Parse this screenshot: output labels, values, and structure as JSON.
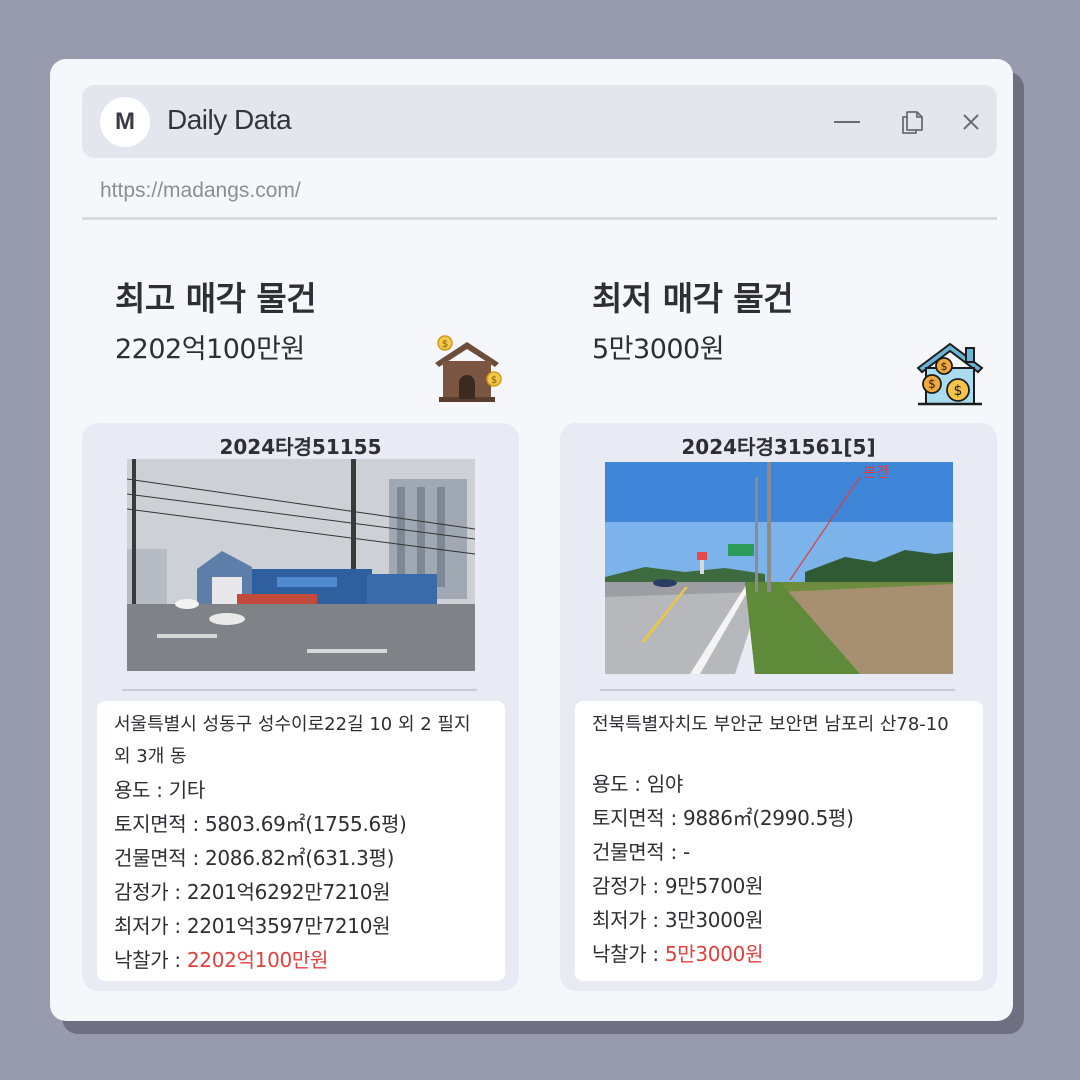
{
  "window": {
    "logo_letter": "M",
    "title": "Daily Data",
    "url": "https://madangs.com/"
  },
  "highest": {
    "heading": "최고 매각 물건",
    "price": "2202억100만원",
    "case_no": "2024타경51155",
    "address": "서울특별시 성동구 성수이로22길 10 외 2 필지 외 3개 동",
    "usage_label": "용도 : ",
    "usage": "기타",
    "land_label": "토지면적 : ",
    "land": "5803.69㎡(1755.6평)",
    "building_label": "건물면적 : ",
    "building": "2086.82㎡(631.3평)",
    "appraisal_label": "감정가 : ",
    "appraisal": "2201억6292만7210원",
    "minimum_label": "최저가 : ",
    "minimum": "2201억3597만7210원",
    "winning_label": "낙찰가 : ",
    "winning": "2202억100만원"
  },
  "lowest": {
    "heading": "최저 매각 물건",
    "price": "5만3000원",
    "case_no": "2024타경31561[5]",
    "photo_annotation": "본건",
    "address": "전북특별자치도 부안군 보안면 남포리 산78-10",
    "usage_label": "용도 : ",
    "usage": "임야",
    "land_label": "토지면적 : ",
    "land": "9886㎡(2990.5평)",
    "building_label": "건물면적 : ",
    "building": "-",
    "appraisal_label": "감정가 : ",
    "appraisal": "9만5700원",
    "minimum_label": "최저가 : ",
    "minimum": "3만3000원",
    "winning_label": "낙찰가 : ",
    "winning": "5만3000원"
  },
  "icons": [
    "minimize-icon",
    "restore-icon",
    "close-icon",
    "house-coin-icon",
    "house-dollar-icon"
  ],
  "colors": {
    "accent_red": "#e0413c",
    "background": "#989aad",
    "card": "#e9ebf4"
  }
}
